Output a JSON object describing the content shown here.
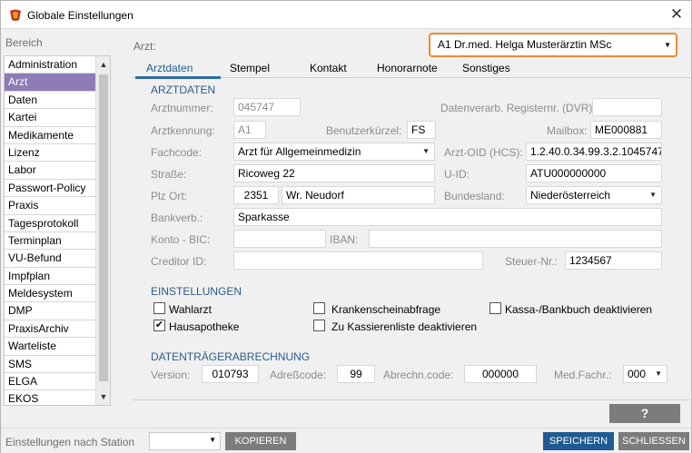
{
  "window": {
    "title": "Globale Einstellungen",
    "close_glyph": "✕",
    "icon": "app-logo-icon"
  },
  "sidebar": {
    "label": "Bereich",
    "items": [
      {
        "label": "Administration"
      },
      {
        "label": "Arzt",
        "selected": true
      },
      {
        "label": "Daten"
      },
      {
        "label": "Kartei"
      },
      {
        "label": "Medikamente"
      },
      {
        "label": "Lizenz"
      },
      {
        "label": "Labor"
      },
      {
        "label": "Passwort-Policy"
      },
      {
        "label": "Praxis"
      },
      {
        "label": "Tagesprotokoll"
      },
      {
        "label": "Terminplan"
      },
      {
        "label": "VU-Befund"
      },
      {
        "label": "Impfplan"
      },
      {
        "label": "Meldesystem"
      },
      {
        "label": "DMP"
      },
      {
        "label": "PraxisArchiv"
      },
      {
        "label": "Warteliste"
      },
      {
        "label": "SMS"
      },
      {
        "label": "ELGA"
      },
      {
        "label": "EKOS"
      }
    ],
    "scroll_up": "▲",
    "scroll_down": "▼",
    "selected_color": "#8e7cb7"
  },
  "header": {
    "arzt_label": "Arzt:",
    "arzt_selected": "A1 Dr.med. Helga Musterärztin MSc",
    "highlight_color": "#ee8a2e"
  },
  "tabs": [
    {
      "label": "Arztdaten",
      "active": true
    },
    {
      "label": "Stempel"
    },
    {
      "label": "Kontakt"
    },
    {
      "label": "Honorarnote"
    },
    {
      "label": "Sonstiges"
    }
  ],
  "arztdaten": {
    "heading": "ARZTDATEN",
    "arztnummer_label": "Arztnummer:",
    "arztnummer_value": "045747",
    "dvr_label": "Datenverarb. Registernr. (DVR):",
    "dvr_value": "",
    "arztkennung_label": "Arztkennung:",
    "arztkennung_value": "A1",
    "benutzerkuerzel_label": "Benutzerkürzel:",
    "benutzerkuerzel_value": "FS",
    "mailbox_label": "Mailbox:",
    "mailbox_value": "ME000881",
    "fachcode_label": "Fachcode:",
    "fachcode_value": "Arzt für Allgemeinmedizin",
    "arzt_oid_label": "Arzt-OID (HCS):",
    "arzt_oid_value": "1.2.40.0.34.99.3.2.1045747",
    "strasse_label": "Straße:",
    "strasse_value": "Ricoweg 22",
    "uid_label": "U-ID:",
    "uid_value": "ATU000000000",
    "plz_ort_label": "Plz Ort:",
    "plz_value": "2351",
    "ort_value": "Wr. Neudorf",
    "bundesland_label": "Bundesland:",
    "bundesland_value": "Niederösterreich",
    "bankverb_label": "Bankverb.:",
    "bankverb_value": "Sparkasse",
    "konto_bic_label": "Konto - BIC:",
    "konto_bic_value": "",
    "iban_label": "IBAN:",
    "iban_value": "",
    "creditor_label": "Creditor ID:",
    "creditor_value": "",
    "steuer_label": "Steuer-Nr.:",
    "steuer_value": "1234567"
  },
  "einstellungen": {
    "heading": "EINSTELLUNGEN",
    "wahlarzt_label": "Wahlarzt",
    "wahlarzt_checked": false,
    "krankenschein_label": "Krankenscheinabfrage",
    "krankenschein_checked": false,
    "kassa_label": "Kassa-/Bankbuch deaktivieren",
    "kassa_checked": false,
    "hausapotheke_label": "Hausapotheke",
    "hausapotheke_checked": true,
    "kassierenliste_label": "Zu Kassierenliste deaktivieren",
    "kassierenliste_checked": false,
    "check_glyph": "✔"
  },
  "datentraeger": {
    "heading": "DATENTRÄGERABRECHNUNG",
    "version_label": "Version:",
    "version_value": "010793",
    "adresscode_label": "Adreßcode:",
    "adresscode_value": "99",
    "abrechn_label": "Abrechn.code:",
    "abrechn_value": "000000",
    "medfachr_label": "Med.Fachr.:",
    "medfachr_value": "000"
  },
  "footer": {
    "help_label": "?",
    "station_label": "Einstellungen nach Station",
    "station_value": "",
    "kopieren_label": "KOPIEREN",
    "speichern_label": "SPEICHERN",
    "schliessen_label": "SCHLIESSEN",
    "primary_color": "#1f5b92",
    "secondary_color": "#7c7c7c"
  }
}
